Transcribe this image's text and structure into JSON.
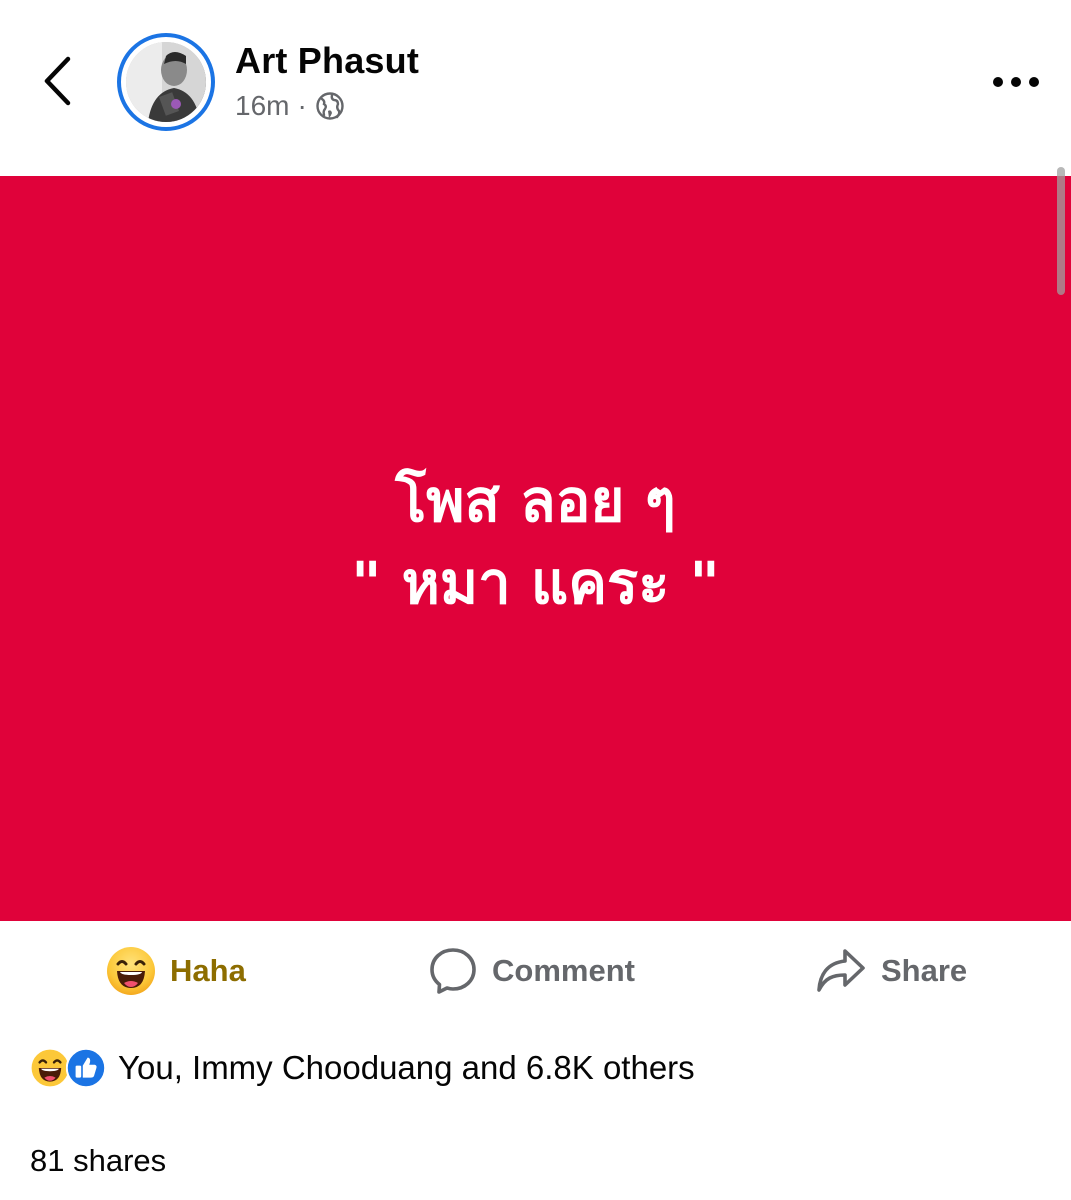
{
  "post": {
    "author": "Art Phasut",
    "time": "16m",
    "separator": "·",
    "audience_icon": "globe-icon",
    "background_color": "#e0023a",
    "text_lines": [
      "โพส ลอย ๆ",
      "\" หมา แคระ \""
    ]
  },
  "actions": {
    "reaction_label": "Haha",
    "comment_label": "Comment",
    "share_label": "Share"
  },
  "reactions_summary": {
    "icons": [
      "haha-icon",
      "like-icon"
    ],
    "text": "You, Immy Chooduang and 6.8K others"
  },
  "shares_text": "81 shares",
  "colors": {
    "accent": "#1b74e4",
    "haha_text": "#8d6d00",
    "secondary_text": "#65676b"
  }
}
